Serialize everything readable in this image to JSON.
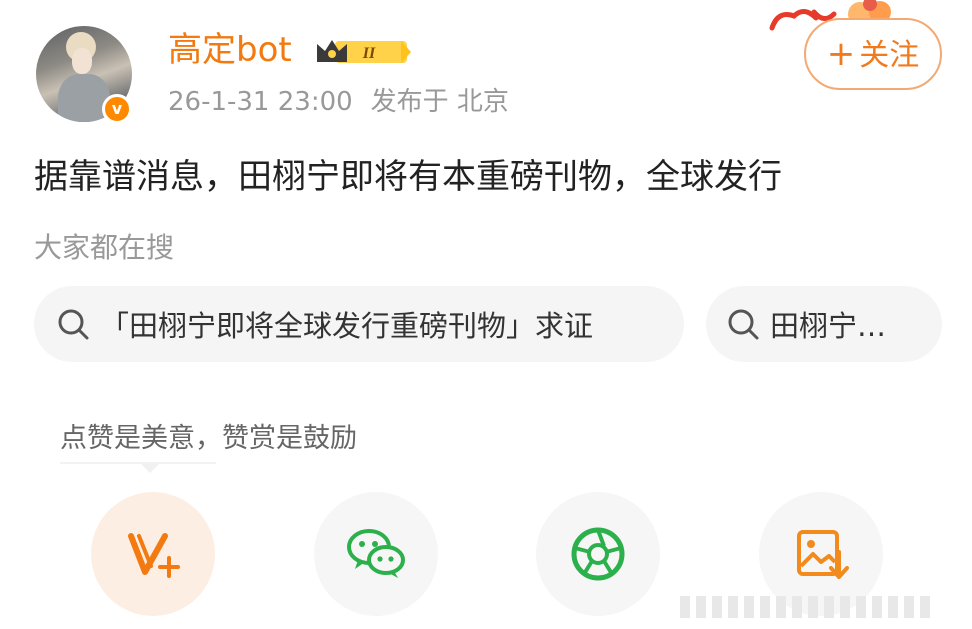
{
  "post": {
    "username": "高定bot",
    "level_badge": "II",
    "timestamp": "26-1-31 23:00",
    "location": "发布于 北京",
    "text": "据靠谱消息，田栩宁即将有本重磅刊物，全球发行",
    "verified_mark": "v"
  },
  "follow_button": {
    "plus": "+",
    "label": "关注"
  },
  "search": {
    "label": "大家都在搜",
    "chips": [
      {
        "text": "「田栩宁即将全球发行重磅刊物」求证"
      },
      {
        "text": "田栩宁…"
      }
    ]
  },
  "reward": {
    "tip": "点赞是美意，赞赏是鼓励",
    "actions": [
      {
        "icon": "reward-v-icon"
      },
      {
        "icon": "wechat-icon"
      },
      {
        "icon": "moments-icon"
      },
      {
        "icon": "save-image-icon"
      }
    ]
  },
  "colors": {
    "accent": "#f27a10",
    "meta_gray": "#999999",
    "chip_bg": "#f5f5f5",
    "wechat_green": "#2bb04b"
  }
}
